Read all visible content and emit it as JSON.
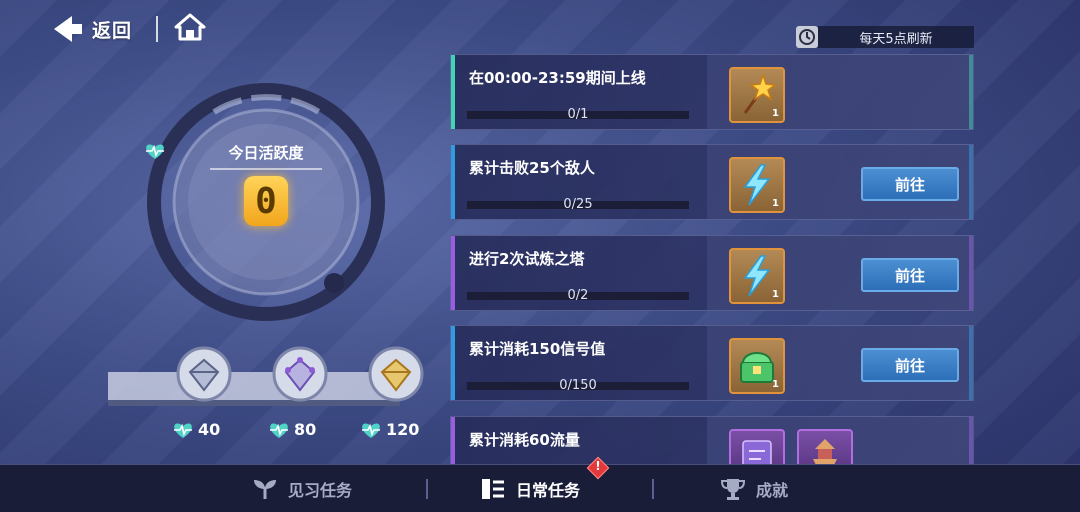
{
  "nav": {
    "back_label": "返回"
  },
  "refresh": {
    "text": "每天5点刷新"
  },
  "activity": {
    "title": "今日活跃度",
    "value": "0",
    "progress": 0
  },
  "milestones": [
    {
      "points": "40",
      "tier": "silver"
    },
    {
      "points": "80",
      "tier": "purple"
    },
    {
      "points": "120",
      "tier": "gold"
    }
  ],
  "tasks": [
    {
      "name": "在00:00-23:59期间上线",
      "progress": "0/1",
      "accent": "#3fd6b6",
      "reward_count": "1",
      "reward_icon": "star-wand-icon",
      "go_label": ""
    },
    {
      "name": "累计击败25个敌人",
      "progress": "0/25",
      "accent": "#2f9be0",
      "reward_count": "1",
      "reward_icon": "lightning-icon",
      "go_label": "前往"
    },
    {
      "name": "进行2次试炼之塔",
      "progress": "0/2",
      "accent": "#9a5ce0",
      "reward_count": "1",
      "reward_icon": "lightning-icon",
      "go_label": "前往"
    },
    {
      "name": "累计消耗150信号值",
      "progress": "0/150",
      "accent": "#2f9be0",
      "reward_count": "1",
      "reward_icon": "green-chest-icon",
      "go_label": "前往"
    },
    {
      "name": "累计消耗60流量",
      "progress": "",
      "accent": "#9a5ce0",
      "reward_count": "",
      "reward_icon": "card-icon",
      "go_label": ""
    }
  ],
  "tabs": [
    {
      "label": "见习任务",
      "active": false
    },
    {
      "label": "日常任务",
      "active": true
    },
    {
      "label": "成就",
      "active": false
    }
  ],
  "badge": {
    "mark": "!"
  },
  "colors": {
    "go_button": "#3a7fc6",
    "activity_value": "#f2b42a",
    "bottom_bar": "#1a1d38"
  }
}
